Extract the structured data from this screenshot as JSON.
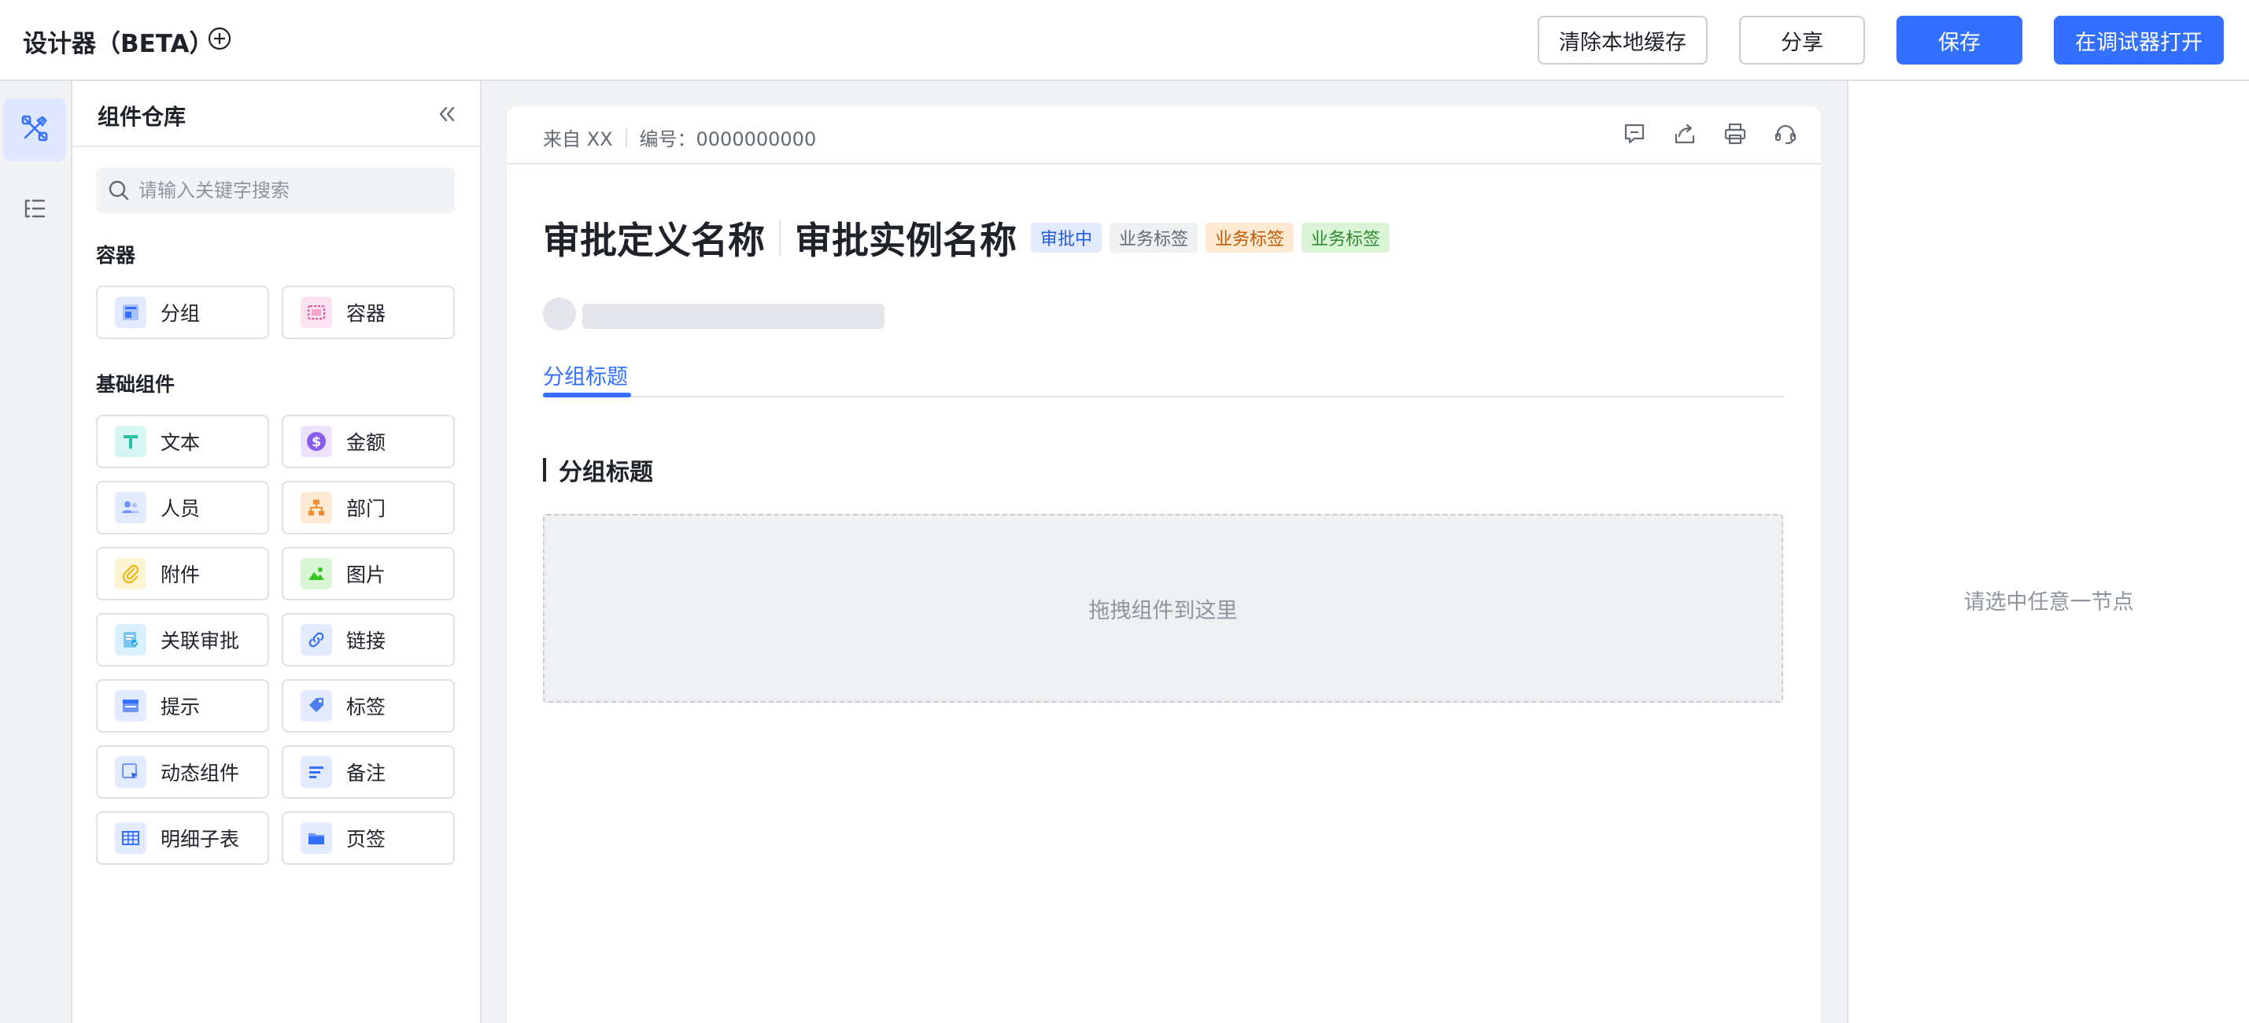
{
  "header": {
    "title": "设计器（BETA）",
    "buttons": {
      "clear_cache": "清除本地缓存",
      "share": "分享",
      "save": "保存",
      "open_debugger": "在调试器打开"
    }
  },
  "panel": {
    "title": "组件仓库",
    "search_placeholder": "请输入关键字搜索",
    "sections": {
      "container": {
        "title": "容器",
        "items": [
          {
            "label": "分组",
            "icon": "group-icon"
          },
          {
            "label": "容器",
            "icon": "container-icon"
          }
        ]
      },
      "basic": {
        "title": "基础组件",
        "items": [
          {
            "label": "文本",
            "icon": "text-icon"
          },
          {
            "label": "金额",
            "icon": "amount-icon"
          },
          {
            "label": "人员",
            "icon": "person-icon"
          },
          {
            "label": "部门",
            "icon": "department-icon"
          },
          {
            "label": "附件",
            "icon": "attachment-icon"
          },
          {
            "label": "图片",
            "icon": "image-icon"
          },
          {
            "label": "关联审批",
            "icon": "related-approval-icon"
          },
          {
            "label": "链接",
            "icon": "link-icon"
          },
          {
            "label": "提示",
            "icon": "tip-icon"
          },
          {
            "label": "标签",
            "icon": "tag-icon"
          },
          {
            "label": "动态组件",
            "icon": "dynamic-component-icon"
          },
          {
            "label": "备注",
            "icon": "note-icon"
          },
          {
            "label": "明细子表",
            "icon": "detail-table-icon"
          },
          {
            "label": "页签",
            "icon": "page-tab-icon"
          }
        ]
      }
    }
  },
  "canvas": {
    "meta_source": "来自 XX",
    "meta_number": "编号：0000000000",
    "title_definition": "审批定义名称",
    "title_instance": "审批实例名称",
    "tags": [
      {
        "label": "审批中",
        "bg": "#e1eaff",
        "fg": "#245bdb"
      },
      {
        "label": "业务标签",
        "bg": "#eff0f1",
        "fg": "#646a73"
      },
      {
        "label": "业务标签",
        "bg": "#feead2",
        "fg": "#c25700"
      },
      {
        "label": "业务标签",
        "bg": "#d9f5d6",
        "fg": "#2e8a2e"
      }
    ],
    "tab_label": "分组标题",
    "group_title": "分组标题",
    "dropzone_text": "拖拽组件到这里"
  },
  "props": {
    "empty_text": "请选中任意一节点"
  },
  "colors": {
    "primary": "#3370ff",
    "border": "#dee0e3",
    "muted_text": "#8f959e"
  }
}
